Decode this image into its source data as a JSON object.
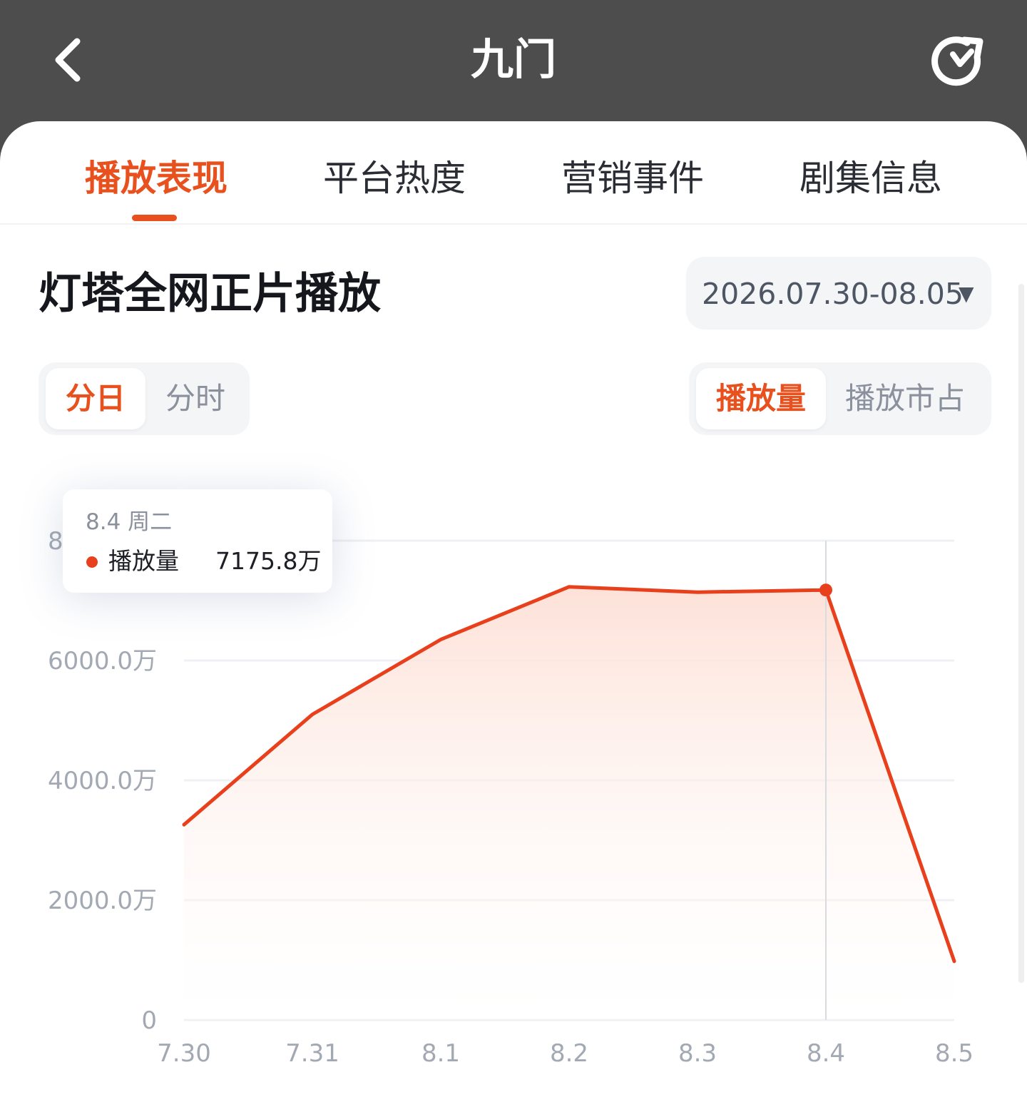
{
  "header": {
    "title": "九门",
    "back_icon": "chevron-left-icon",
    "refresh_icon": "refresh-icon"
  },
  "tabs": [
    {
      "label": "播放表现",
      "active": true
    },
    {
      "label": "平台热度",
      "active": false
    },
    {
      "label": "营销事件",
      "active": false
    },
    {
      "label": "剧集信息",
      "active": false
    }
  ],
  "section": {
    "title": "灯塔全网正片播放",
    "date_range": "2026.07.30-08.05",
    "dropdown_icon": "caret-down-icon"
  },
  "granularity": {
    "options": [
      "分日",
      "分时"
    ],
    "selected": "分日"
  },
  "metric": {
    "options": [
      "播放量",
      "播放市占"
    ],
    "selected": "播放量"
  },
  "tooltip": {
    "date": "8.4  周二",
    "series_label": "播放量",
    "value": "7175.8万"
  },
  "colors": {
    "accent": "#e8501e",
    "line": "#e8401c",
    "header_bg": "#4d4d4d"
  },
  "chart_data": {
    "type": "area",
    "title": "",
    "categories": [
      "7.30",
      "7.31",
      "8.1",
      "8.2",
      "8.3",
      "8.4",
      "8.5"
    ],
    "series": [
      {
        "name": "播放量",
        "values": [
          3260,
          5100,
          6350,
          7230,
          7140,
          7175.8,
          980
        ]
      }
    ],
    "y_unit": "万",
    "y_ticks": [
      "0",
      "2000.0万",
      "4000.0万",
      "6000.0万",
      "8000.0万"
    ],
    "ylim": [
      0,
      8000
    ],
    "grid": true,
    "highlighted_category": "8.4"
  }
}
